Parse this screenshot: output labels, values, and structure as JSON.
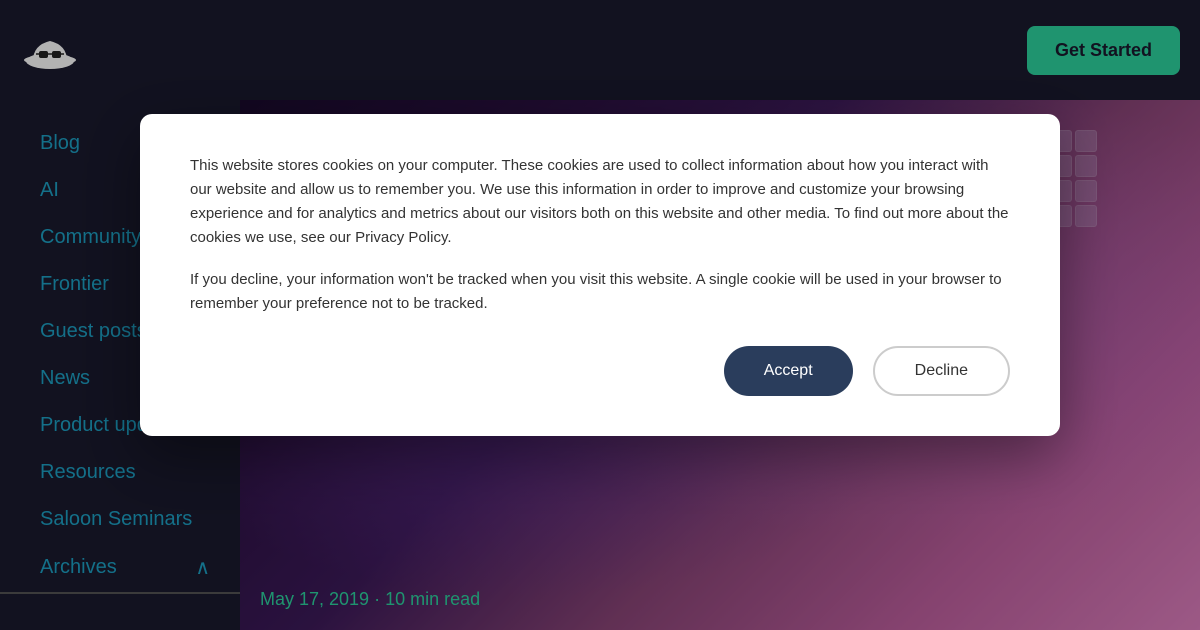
{
  "header": {
    "get_started_label": "Get Started"
  },
  "sidebar": {
    "items": [
      {
        "id": "blog",
        "label": "Blog"
      },
      {
        "id": "ai",
        "label": "AI"
      },
      {
        "id": "community",
        "label": "Community"
      },
      {
        "id": "frontier",
        "label": "Frontier"
      },
      {
        "id": "guest-posts",
        "label": "Guest posts"
      },
      {
        "id": "news",
        "label": "News"
      },
      {
        "id": "product-updates",
        "label": "Product updates"
      },
      {
        "id": "resources",
        "label": "Resources"
      },
      {
        "id": "saloon-seminars",
        "label": "Saloon Seminars"
      },
      {
        "id": "archives",
        "label": "Archives"
      }
    ]
  },
  "hero": {
    "post_meta": "May 17, 2019 · 10 min read"
  },
  "cookie_modal": {
    "paragraph1": "This website stores cookies on your computer. These cookies are used to collect information about how you interact with our website and allow us to remember you. We use this information in order to improve and customize your browsing experience and for analytics and metrics about our visitors both on this website and other media. To find out more about the cookies we use, see our Privacy Policy.",
    "paragraph2": "If you decline, your information won't be tracked when you visit this website. A single cookie will be used in your browser to remember your preference not to be tracked.",
    "accept_label": "Accept",
    "decline_label": "Decline"
  },
  "icons": {
    "archives_chevron": "∧",
    "logo_unicode": "🤠"
  }
}
